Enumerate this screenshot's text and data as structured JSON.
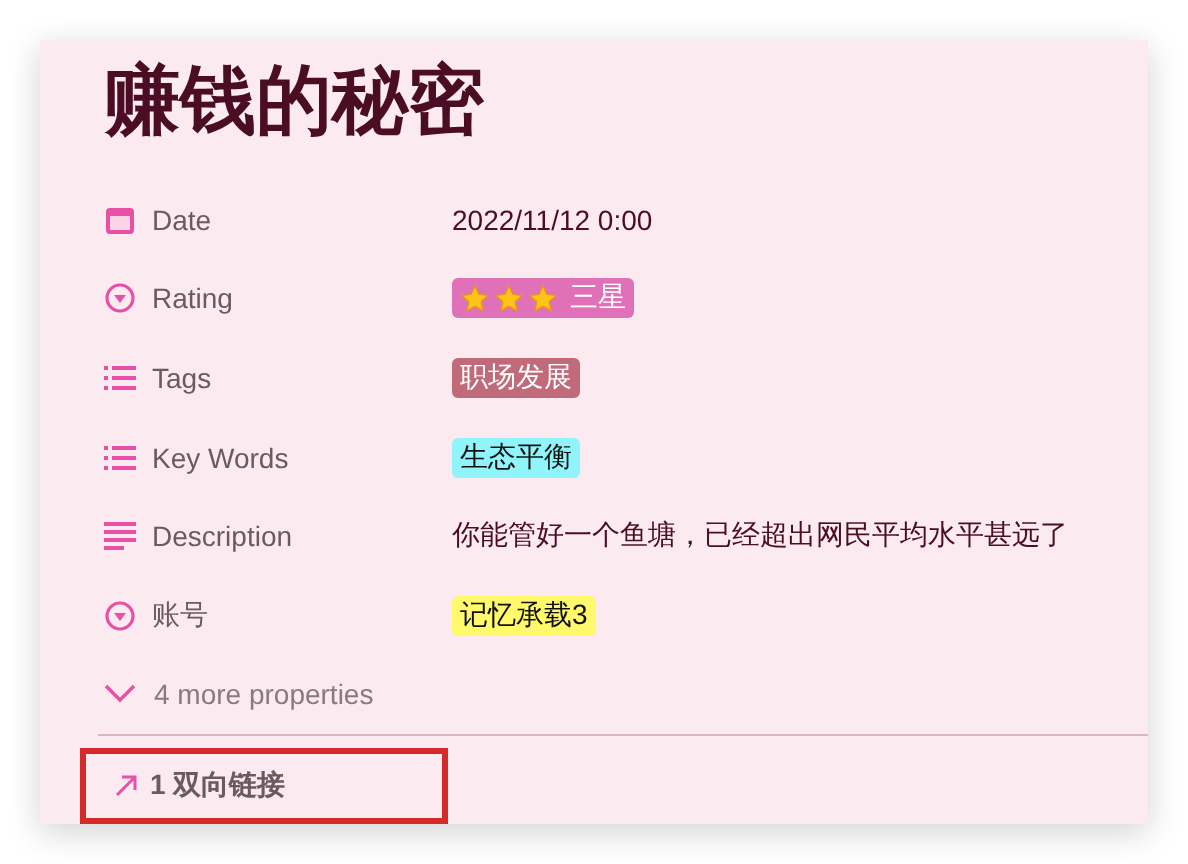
{
  "title": "赚钱的秘密",
  "properties": [
    {
      "kind": "date",
      "name": "Date",
      "value": "2022/11/12 0:00"
    },
    {
      "kind": "select",
      "name": "Rating",
      "stars": 3,
      "value": "三星",
      "color": "#e070b8"
    },
    {
      "kind": "multi_select",
      "name": "Tags",
      "value": "职场发展",
      "color": "#c06a7a"
    },
    {
      "kind": "multi_select",
      "name": "Key Words",
      "value": "生态平衡",
      "color": "#90f5fa"
    },
    {
      "kind": "text",
      "name": "Description",
      "value": "你能管好一个鱼塘，已经超出网民平均水平甚远了"
    },
    {
      "kind": "select",
      "name": "账号",
      "value": "记忆承载3",
      "color": "#fff96b"
    }
  ],
  "more_properties": {
    "label": "4 more properties",
    "expanded": false
  },
  "backlinks": {
    "label": "1 双向链接",
    "highlighted": true
  }
}
